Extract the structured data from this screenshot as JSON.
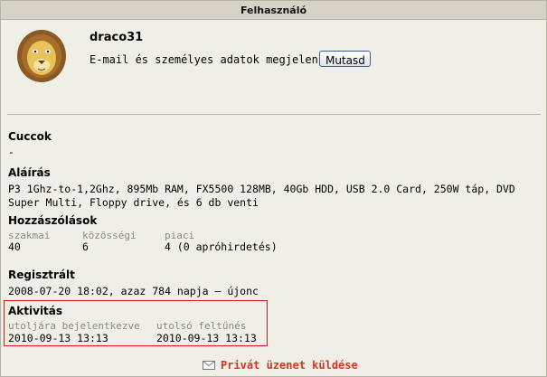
{
  "header": {
    "title": "Felhasználó"
  },
  "user": {
    "name": "draco31",
    "email_label": "E-mail és személyes adatok megjelenítése:",
    "show_button": "Mutasd"
  },
  "sections": {
    "cuccok": {
      "title": "Cuccok",
      "value": "-"
    },
    "alairas": {
      "title": "Aláírás",
      "value": "P3 1Ghz-to-1,2Ghz, 895Mb RAM, FX5500 128MB, 40Gb HDD, USB 2.0 Card, 250W táp, DVD Super Multi, Floppy drive, és 6 db venti"
    },
    "hozzaszolasok": {
      "title": "Hozzászólások",
      "cols": [
        {
          "label": "szakmai",
          "value": "40"
        },
        {
          "label": "közösségi",
          "value": "6"
        },
        {
          "label": "piaci",
          "value": "4 (0 apróhirdetés)"
        }
      ]
    },
    "regisztralt": {
      "title": "Regisztrált",
      "value": "2008-07-20 18:02, azaz 784 napja — újonc"
    },
    "aktivitas": {
      "title": "Aktivitás",
      "cols": [
        {
          "label": "utoljára bejelentkezve",
          "value": "2010-09-13 13:13"
        },
        {
          "label": "utolsó feltűnés",
          "value": "2010-09-13 13:13"
        }
      ]
    }
  },
  "footer": {
    "pm_link": "Privát üzenet küldése"
  },
  "colors": {
    "background": "#f0efe7",
    "header": "#d6d3c6",
    "highlight_border": "#e0161e",
    "link": "#d9331f"
  },
  "icons": {
    "avatar": "lion-avatar",
    "pm": "envelope-icon"
  }
}
